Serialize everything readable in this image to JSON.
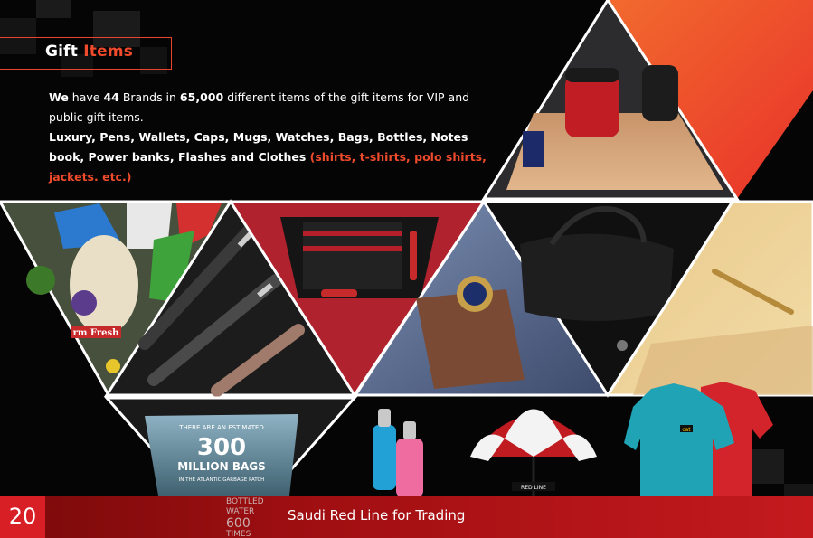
{
  "header": {
    "title_main": "Gift",
    "title_accent": "Items"
  },
  "intro": {
    "p1_we": "We",
    "p1_a": " have ",
    "p1_brands": "44",
    "p1_b": " Brands in ",
    "p1_items": "65,000",
    "p1_c": " different items of the gift items for VIP and public  gift items.",
    "p2": "Luxury, Pens, Wallets, Caps, Mugs, Watches, Bags, Bottles, Notes book, Power banks, Flashes and Clothes ",
    "p2_accent": "(shirts, t-shirts, polo shirts, jackets. etc.)"
  },
  "photo_text": {
    "bag_label": "rm Fresh",
    "mug_line1": "THERE ARE AN ESTIMATED",
    "mug_line2": "300",
    "mug_line3": "MILLION BAGS",
    "mug_line4": "IN THE ATLANTIC GARBAGE PATCH",
    "umbrella": "RED LINE",
    "polo_logo": "cat",
    "bottled_l1": "BOTTLED",
    "bottled_l2": "WATER",
    "bottled_l3": "600",
    "bottled_l4": "TIMES"
  },
  "footer": {
    "page_number": "20",
    "company": "Saudi Red Line for Trading"
  },
  "colors": {
    "accent": "#ef4a2b",
    "footer_red": "#c41a1e",
    "page_num_bg": "#d81f26"
  }
}
